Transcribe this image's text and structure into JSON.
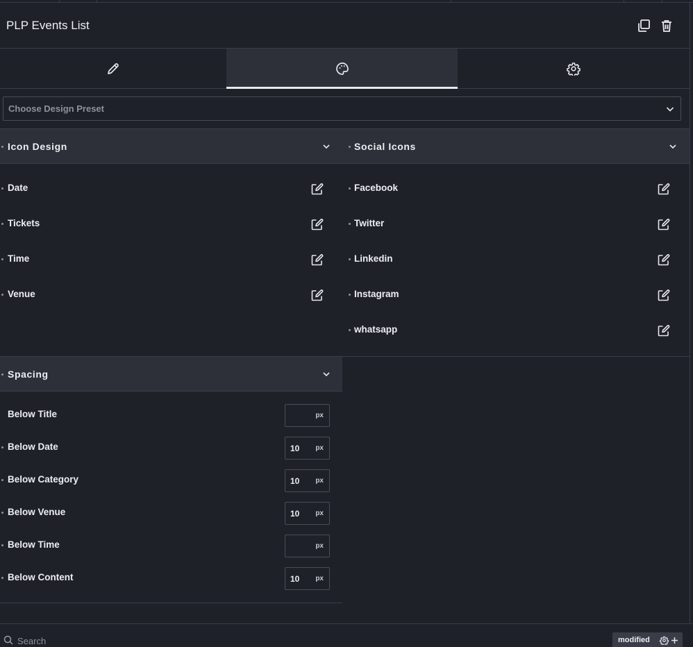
{
  "header": {
    "title": "PLP Events List"
  },
  "tabs": [
    {
      "name": "content",
      "icon": "pencil-icon"
    },
    {
      "name": "style",
      "icon": "palette-icon",
      "active": true
    },
    {
      "name": "advanced",
      "icon": "gear-icon"
    }
  ],
  "preset": {
    "placeholder": "Choose Design Preset"
  },
  "icon_design": {
    "title": "Icon Design",
    "items": [
      "Date",
      "Tickets",
      "Time",
      "Venue"
    ]
  },
  "social_icons": {
    "title": "Social Icons",
    "items": [
      "Facebook",
      "Twitter",
      "Linkedin",
      "Instagram",
      "whatsapp"
    ]
  },
  "spacing": {
    "title": "Spacing",
    "unit": "px",
    "rows": [
      {
        "label": "Below Title",
        "value": ""
      },
      {
        "label": "Below Date",
        "value": "10"
      },
      {
        "label": "Below Category",
        "value": "10"
      },
      {
        "label": "Below Venue",
        "value": "10"
      },
      {
        "label": "Below Time",
        "value": ""
      },
      {
        "label": "Below Content",
        "value": "10"
      }
    ]
  },
  "footer": {
    "search_placeholder": "Search",
    "badge": "modified"
  },
  "colors": {
    "bg": "#1f2129",
    "panel": "#2d3039",
    "border": "#3a3d48",
    "text": "#eceef2"
  }
}
